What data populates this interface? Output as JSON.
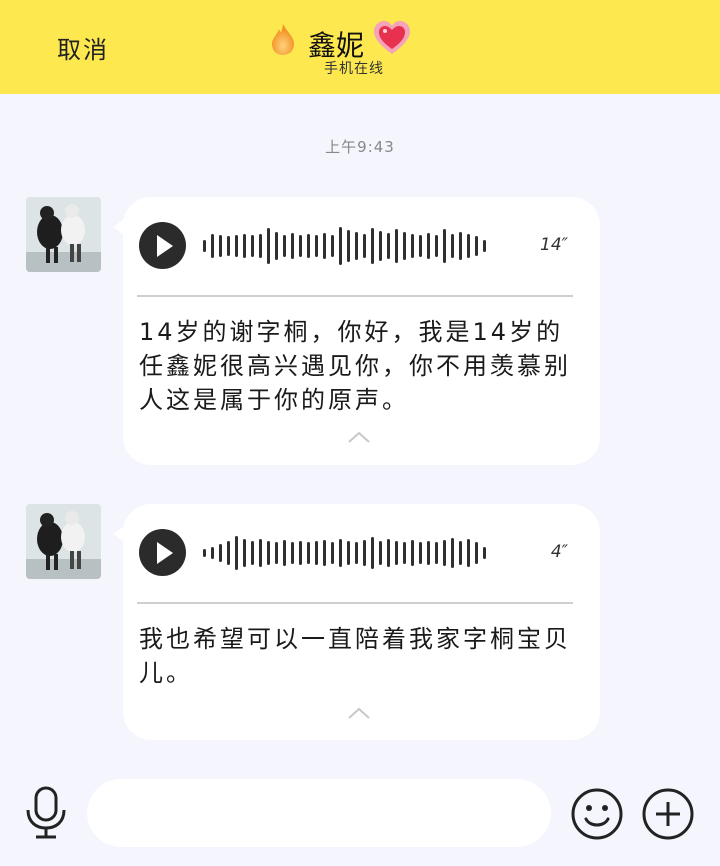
{
  "header": {
    "cancel_label": "取消",
    "title": "鑫妮",
    "status": "手机在线",
    "flame_icon": "flame-icon",
    "heart_icon": "sparkling-heart-icon",
    "bg_color": "#fde84f"
  },
  "chat": {
    "timestamp": "上午9:43",
    "messages": [
      {
        "type": "voice",
        "duration": "14″",
        "transcript": "14岁的谢字桐，你好，我是14岁的任鑫妮很高兴遇见你，你不用羡慕别人这是属于你的原声。"
      },
      {
        "type": "voice",
        "duration": "4″",
        "transcript": "我也希望可以一直陪着我家字桐宝贝儿。"
      }
    ]
  },
  "composer": {
    "input_value": "",
    "mic_icon": "microphone-icon",
    "emoji_icon": "smiley-icon",
    "plus_icon": "plus-circle-icon"
  }
}
